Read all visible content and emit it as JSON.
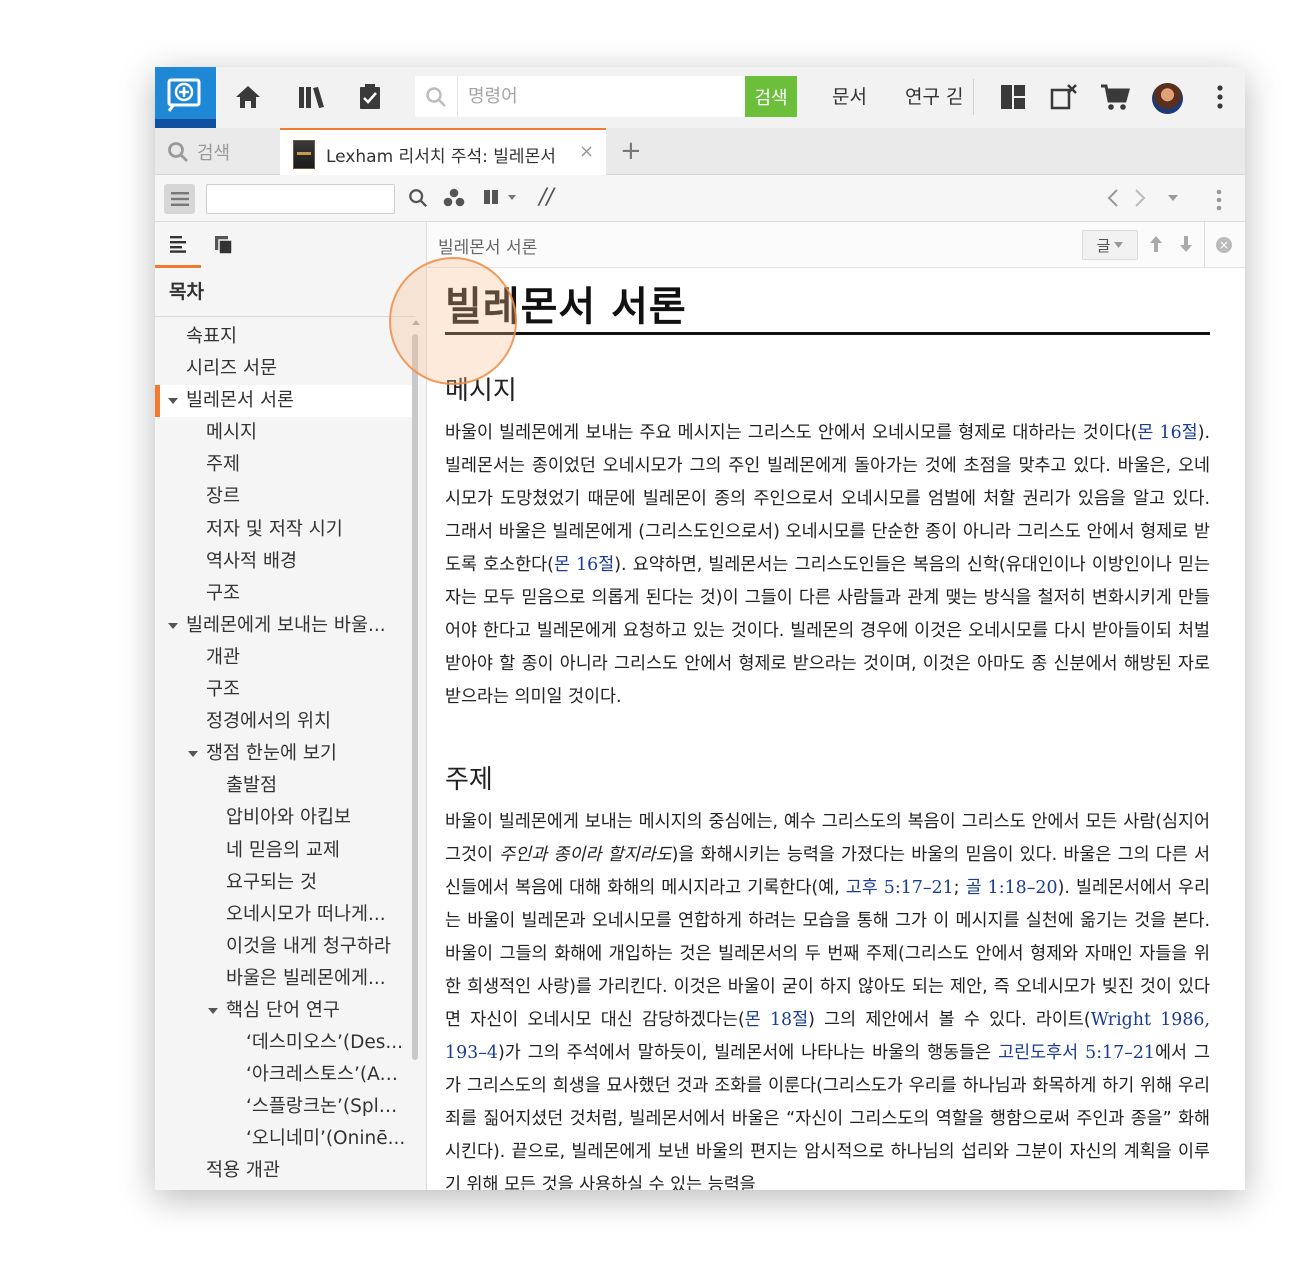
{
  "appbar": {
    "command_placeholder": "명령어",
    "command_button": "검색",
    "menu_docs": "문서",
    "menu_research": "연구 긷",
    "colors": {
      "logo": "#1e88d7",
      "search_button": "#6bbf3b",
      "accent": "#f07a2f"
    }
  },
  "tabs": {
    "search_label": "검색",
    "active_title": "Lexham 리서치 주석: 빌레몬서",
    "close_glyph": "×",
    "add_glyph": "+"
  },
  "toolbar": {
    "parallel_glyph": "//"
  },
  "toc": {
    "heading": "목차",
    "items": [
      {
        "label": "속표지",
        "level": 1,
        "caret": false,
        "selected": false
      },
      {
        "label": "시리즈 서문",
        "level": 1,
        "caret": false,
        "selected": false
      },
      {
        "label": "빌레몬서 서론",
        "level": 1,
        "caret": true,
        "selected": true
      },
      {
        "label": "메시지",
        "level": 2,
        "caret": false,
        "selected": false
      },
      {
        "label": "주제",
        "level": 2,
        "caret": false,
        "selected": false
      },
      {
        "label": "장르",
        "level": 2,
        "caret": false,
        "selected": false
      },
      {
        "label": "저자 및 저작 시기",
        "level": 2,
        "caret": false,
        "selected": false
      },
      {
        "label": "역사적 배경",
        "level": 2,
        "caret": false,
        "selected": false
      },
      {
        "label": "구조",
        "level": 2,
        "caret": false,
        "selected": false
      },
      {
        "label": "빌레몬에게 보내는 바울...",
        "level": 1,
        "caret": true,
        "selected": false
      },
      {
        "label": "개관",
        "level": 2,
        "caret": false,
        "selected": false
      },
      {
        "label": "구조",
        "level": 2,
        "caret": false,
        "selected": false
      },
      {
        "label": "정경에서의 위치",
        "level": 2,
        "caret": false,
        "selected": false
      },
      {
        "label": "쟁점 한눈에 보기",
        "level": 2,
        "caret": true,
        "selected": false
      },
      {
        "label": "출발점",
        "level": 3,
        "caret": false,
        "selected": false
      },
      {
        "label": "압비아와 아킵보",
        "level": 3,
        "caret": false,
        "selected": false
      },
      {
        "label": "네 믿음의 교제",
        "level": 3,
        "caret": false,
        "selected": false
      },
      {
        "label": "요구되는 것",
        "level": 3,
        "caret": false,
        "selected": false
      },
      {
        "label": "오네시모가 떠나게...",
        "level": 3,
        "caret": false,
        "selected": false
      },
      {
        "label": "이것을 내게 청구하라",
        "level": 3,
        "caret": false,
        "selected": false
      },
      {
        "label": "바울은 빌레몬에게...",
        "level": 3,
        "caret": false,
        "selected": false
      },
      {
        "label": "핵심 단어 연구",
        "level": 3,
        "caret": true,
        "selected": false
      },
      {
        "label": "‘데스미오스’(Des...",
        "level": 4,
        "caret": false,
        "selected": false
      },
      {
        "label": "‘아크레스토스’(Ac...",
        "level": 4,
        "caret": false,
        "selected": false
      },
      {
        "label": "‘스플랑크논’(Spla...",
        "level": 4,
        "caret": false,
        "selected": false
      },
      {
        "label": "‘오니네미’(Oninē...",
        "level": 4,
        "caret": false,
        "selected": false
      },
      {
        "label": "적용 개관",
        "level": 2,
        "caret": false,
        "selected": false
      }
    ]
  },
  "content": {
    "breadcrumb": "빌레몬서 서론",
    "format_label": "글",
    "title": "빌레몬서 서론",
    "section1": {
      "heading": "메시지",
      "t1": "바울이 빌레몬에게 보내는 주요 메시지는 그리스도 안에서 오네시모를 형제로 대하라는 것이다(",
      "l1": "몬 16절",
      "t2": "). 빌레몬서는 종이었던 오네시모가 그의 주인 빌레몬에게 돌아가는 것에 초점을 맞추고 있다. 바울은, 오네시모가 도망쳤었기 때문에 빌레몬이 종의 주인으로서 오네시모를 엄벌에 처할 권리가 있음을 알고 있다. 그래서 바울은 빌레몬에게 (그리스도인으로서) 오네시모를 단순한 종이 아니라 그리스도 안에서 형제로 받도록 호소한다(",
      "l2": "몬 16절",
      "t3": "). 요약하면, 빌레몬서는 그리스도인들은 복음의 신학(유대인이나 이방인이나 믿는 자는 모두 믿음으로 의롭게 된다는 것)이 그들이 다른 사람들과 관계 맺는 방식을 철저히 변화시키게 만들어야 한다고 빌레몬에게 요청하고 있는 것이다. 빌레몬의 경우에 이것은 오네시모를 다시 받아들이되 처벌받아야 할 종이 아니라 그리스도 안에서 형제로 받으라는 것이며, 이것은 아마도 종 신분에서 해방된 자로 받으라는 의미일 것이다."
    },
    "section2": {
      "heading": "주제",
      "t1": "바울이 빌레몬에게 보내는 메시지의 중심에는, 예수 그리스도의 복음이 그리스도 안에서 모든 사람(심지어 그것이 ",
      "em1": "주인과 종이라 할지라도",
      "t2": ")을 화해시키는 능력을 가졌다는 바울의 믿음이 있다. 바울은 그의 다른 서신들에서 복음에 대해 화해의 메시지라고 기록한다(예, ",
      "l1": "고후 5:17–21",
      "t3": "; ",
      "l2": "골 1:18–20",
      "t4": "). 빌레몬서에서 우리는 바울이 빌레몬과 오네시모를 연합하게 하려는 모습을 통해 그가 이 메시지를 실천에 옮기는 것을 본다. 바울이 그들의 화해에 개입하는 것은 빌레몬서의 두 번째 주제(그리스도 안에서 형제와 자매인 자들을 위한 희생적인 사랑)를 가리킨다. 이것은 바울이 굳이 하지 않아도 되는 제안, 즉 오네시모가 빚진 것이 있다면 자신이 오네시모 대신 감당하겠다는(",
      "l3": "몬 18절",
      "t5": ") 그의 제안에서 볼 수 있다. 라이트(",
      "l4": "Wright 1986, 193–4",
      "t6": ")가 그의 주석에서 말하듯이, 빌레몬서에 나타나는 바울의 행동들은 ",
      "l5": "고린도후서 5:17–21",
      "t7": "에서 그가 그리스도의 희생을 묘사했던 것과 조화를 이룬다(그리스도가 우리를 하나님과 화목하게 하기 위해 우리 죄를 짊어지셨던 것처럼, 빌레몬서에서 바울은 “자신이 그리스도의 역할을 행함으로써 주인과 종을” 화해시킨다). 끝으로, 빌레몬에게 보낸 바울의 편지는 암시적으로 하나님의 섭리와 그분이 자신의 계획을 이루기 위해 모든 것을 사용하실 수 있는 능력을"
    }
  }
}
